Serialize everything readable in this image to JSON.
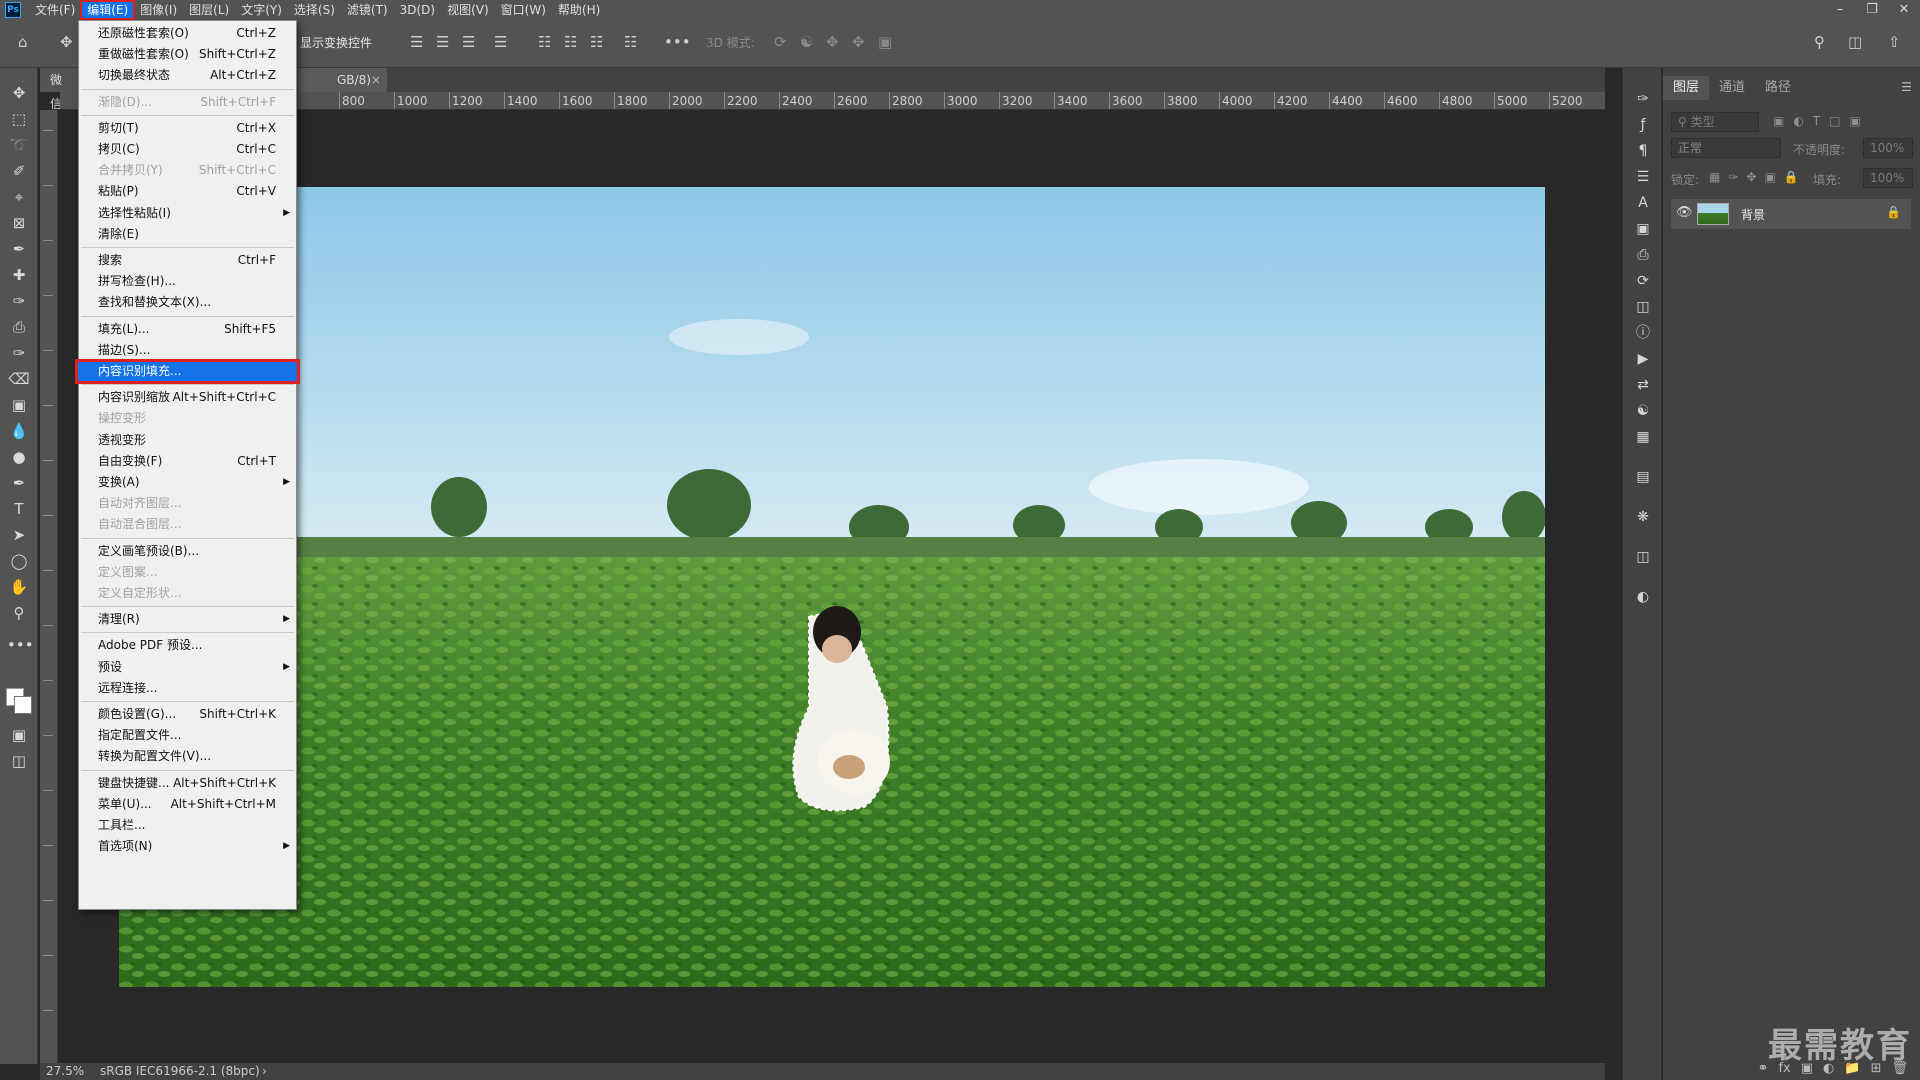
{
  "menubar": {
    "logo": "Ps",
    "items": [
      "文件(F)",
      "编辑(E)",
      "图像(I)",
      "图层(L)",
      "文字(Y)",
      "选择(S)",
      "滤镜(T)",
      "3D(D)",
      "视图(V)",
      "窗口(W)",
      "帮助(H)"
    ],
    "active_index": 1
  },
  "options": {
    "show_transform": "显示变换控件",
    "mode_3d": "3D 模式:"
  },
  "doc": {
    "tab1": "微信",
    "tab2": "GB/8)",
    "tab_close": "×",
    "ruler_ticks": [
      "800",
      "1000",
      "1200",
      "1400",
      "1600",
      "1800",
      "2000",
      "2200",
      "2400",
      "2600",
      "2800",
      "3000",
      "3200",
      "3400",
      "3600",
      "3800",
      "4000",
      "4200",
      "4400",
      "4600",
      "4800",
      "5000",
      "5200"
    ]
  },
  "status": {
    "zoom": "27.5%",
    "profile": "sRGB IEC61966-2.1 (8bpc)",
    "arrow": "›"
  },
  "panel": {
    "tabs": [
      "图层",
      "通道",
      "路径"
    ],
    "kind_placeholder": "类型",
    "blend_mode": "正常",
    "opacity_label": "不透明度:",
    "opacity_value": "100%",
    "lock_label": "锁定:",
    "fill_label": "填充:",
    "fill_value": "100%",
    "layer_name": "背景"
  },
  "watermark": "最需教育",
  "edit_menu": {
    "items": [
      {
        "label": "还原磁性套索(O)",
        "shortcut": "Ctrl+Z",
        "state": "enabled"
      },
      {
        "label": "重做磁性套索(O)",
        "shortcut": "Shift+Ctrl+Z",
        "state": "enabled"
      },
      {
        "label": "切换最终状态",
        "shortcut": "Alt+Ctrl+Z",
        "state": "enabled"
      },
      {
        "label": "渐隐(D)...",
        "shortcut": "Shift+Ctrl+F",
        "state": "disabled"
      },
      {
        "label": "剪切(T)",
        "shortcut": "Ctrl+X",
        "state": "enabled"
      },
      {
        "label": "拷贝(C)",
        "shortcut": "Ctrl+C",
        "state": "enabled"
      },
      {
        "label": "合并拷贝(Y)",
        "shortcut": "Shift+Ctrl+C",
        "state": "disabled"
      },
      {
        "label": "粘贴(P)",
        "shortcut": "Ctrl+V",
        "state": "enabled"
      },
      {
        "label": "选择性粘贴(I)",
        "shortcut": "",
        "state": "submenu"
      },
      {
        "label": "清除(E)",
        "shortcut": "",
        "state": "enabled"
      },
      {
        "label": "搜索",
        "shortcut": "Ctrl+F",
        "state": "enabled"
      },
      {
        "label": "拼写检查(H)...",
        "shortcut": "",
        "state": "enabled"
      },
      {
        "label": "查找和替换文本(X)...",
        "shortcut": "",
        "state": "enabled"
      },
      {
        "label": "填充(L)...",
        "shortcut": "Shift+F5",
        "state": "enabled"
      },
      {
        "label": "描边(S)...",
        "shortcut": "",
        "state": "enabled"
      },
      {
        "label": "内容识别填充...",
        "shortcut": "",
        "state": "highlighted"
      },
      {
        "label": "内容识别缩放",
        "shortcut": "Alt+Shift+Ctrl+C",
        "state": "enabled"
      },
      {
        "label": "操控变形",
        "shortcut": "",
        "state": "disabled"
      },
      {
        "label": "透视变形",
        "shortcut": "",
        "state": "enabled"
      },
      {
        "label": "自由变换(F)",
        "shortcut": "Ctrl+T",
        "state": "enabled"
      },
      {
        "label": "变换(A)",
        "shortcut": "",
        "state": "submenu"
      },
      {
        "label": "自动对齐图层...",
        "shortcut": "",
        "state": "disabled"
      },
      {
        "label": "自动混合图层...",
        "shortcut": "",
        "state": "disabled"
      },
      {
        "label": "定义画笔预设(B)...",
        "shortcut": "",
        "state": "enabled"
      },
      {
        "label": "定义图案...",
        "shortcut": "",
        "state": "disabled"
      },
      {
        "label": "定义自定形状...",
        "shortcut": "",
        "state": "disabled"
      },
      {
        "label": "清理(R)",
        "shortcut": "",
        "state": "submenu"
      },
      {
        "label": "Adobe PDF 预设...",
        "shortcut": "",
        "state": "enabled"
      },
      {
        "label": "预设",
        "shortcut": "",
        "state": "submenu"
      },
      {
        "label": "远程连接...",
        "shortcut": "",
        "state": "enabled"
      },
      {
        "label": "颜色设置(G)...",
        "shortcut": "Shift+Ctrl+K",
        "state": "enabled"
      },
      {
        "label": "指定配置文件...",
        "shortcut": "",
        "state": "enabled"
      },
      {
        "label": "转换为配置文件(V)...",
        "shortcut": "",
        "state": "enabled"
      },
      {
        "label": "键盘快捷键...",
        "shortcut": "Alt+Shift+Ctrl+K",
        "state": "enabled"
      },
      {
        "label": "菜单(U)...",
        "shortcut": "Alt+Shift+Ctrl+M",
        "state": "enabled"
      },
      {
        "label": "工具栏...",
        "shortcut": "",
        "state": "enabled"
      },
      {
        "label": "首选项(N)",
        "shortcut": "",
        "state": "submenu"
      }
    ]
  },
  "colors": {
    "accent": "#1473e6",
    "highlight_border": "#e02020",
    "chrome": "#535353",
    "panel": "#424242",
    "workspace": "#282828"
  }
}
